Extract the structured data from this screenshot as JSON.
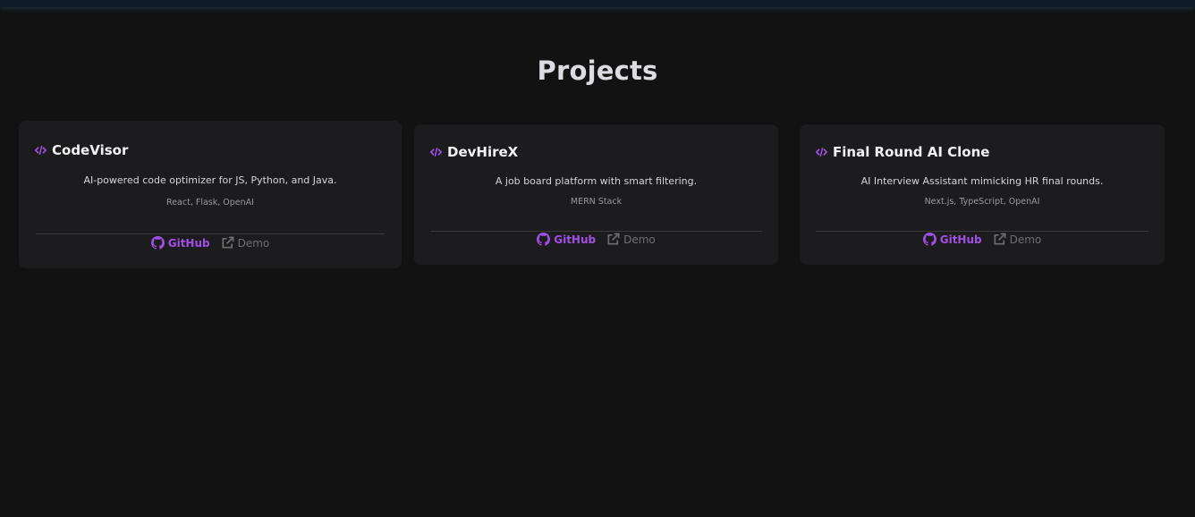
{
  "section": {
    "title": "Projects"
  },
  "colors": {
    "accent": "#a24fe6",
    "background": "#121212",
    "card": "#1c1c1e",
    "muted": "#6e6e72"
  },
  "projects": [
    {
      "icon": "code-icon",
      "title": "CodeVisor",
      "description": "AI-powered code optimizer for JS, Python, and Java.",
      "tech": "React, Flask, OpenAI",
      "github_label": "GitHub",
      "demo_label": "Demo"
    },
    {
      "icon": "code-icon",
      "title": "DevHireX",
      "description": "A job board platform with smart filtering.",
      "tech": "MERN Stack",
      "github_label": "GitHub",
      "demo_label": "Demo"
    },
    {
      "icon": "code-icon",
      "title": "Final Round AI Clone",
      "description": "AI Interview Assistant mimicking HR final rounds.",
      "tech": "Next.js, TypeScript, OpenAI",
      "github_label": "GitHub",
      "demo_label": "Demo"
    }
  ]
}
